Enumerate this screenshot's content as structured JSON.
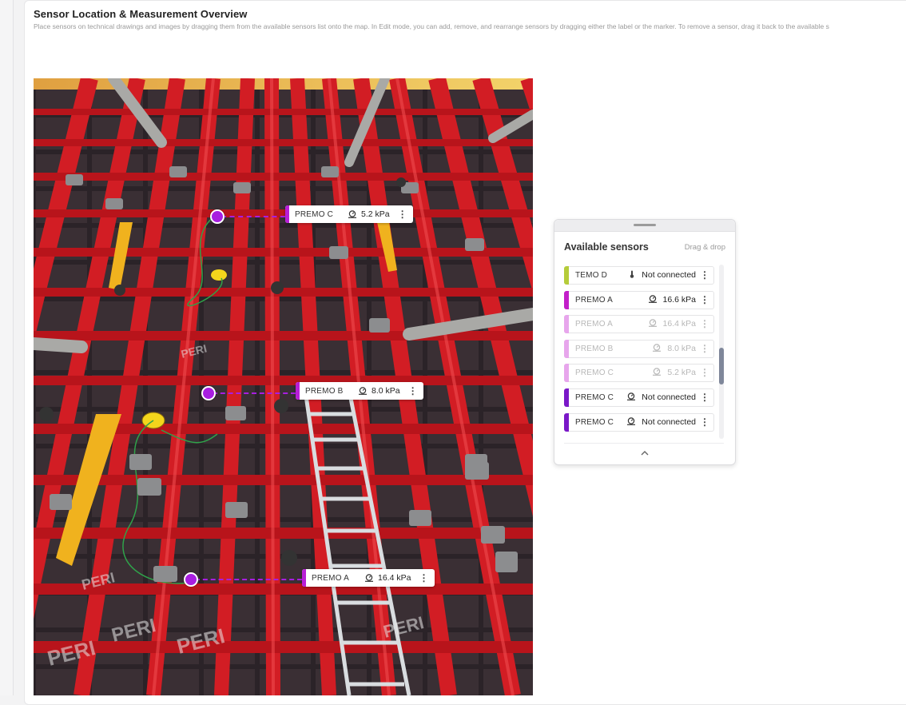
{
  "page": {
    "title": "Sensor Location & Measurement Overview",
    "description": "Place sensors on technical drawings and images by dragging them from the available sensors list onto the map. In Edit mode, you can add, remove, and rearrange sensors by dragging either the label or the marker. To remove a sensor, drag it back to the available s"
  },
  "map": {
    "placed_sensors": [
      {
        "name": "PREMO C",
        "value": "5.2 kPa",
        "icon": "pressure-gauge-icon",
        "color": "#b81ed6"
      },
      {
        "name": "PREMO B",
        "value": "8.0 kPa",
        "icon": "pressure-gauge-icon",
        "color": "#b81ed6"
      },
      {
        "name": "PREMO A",
        "value": "16.4 kPa",
        "icon": "pressure-gauge-icon",
        "color": "#b81ed6"
      }
    ]
  },
  "panel": {
    "title": "Available sensors",
    "hint": "Drag & drop",
    "sensors": [
      {
        "name": "TEMO D",
        "value": "Not connected",
        "icon": "thermometer-icon",
        "color": "#b5cc3a",
        "faded": false
      },
      {
        "name": "PREMO A",
        "value": "16.6 kPa",
        "icon": "pressure-gauge-icon",
        "color": "#c21fc9",
        "faded": false
      },
      {
        "name": "PREMO A",
        "value": "16.4 kPa",
        "icon": "pressure-gauge-icon",
        "color": "#e7a6ec",
        "faded": true
      },
      {
        "name": "PREMO B",
        "value": "8.0 kPa",
        "icon": "pressure-gauge-icon",
        "color": "#e7a6ec",
        "faded": true
      },
      {
        "name": "PREMO C",
        "value": "5.2 kPa",
        "icon": "pressure-gauge-icon",
        "color": "#e7a6ec",
        "faded": true
      },
      {
        "name": "PREMO C",
        "value": "Not connected",
        "icon": "pressure-gauge-icon",
        "color": "#7a18c8",
        "faded": false
      },
      {
        "name": "PREMO C",
        "value": "Not connected",
        "icon": "pressure-gauge-icon",
        "color": "#7a18c8",
        "faded": false
      }
    ]
  },
  "colors": {
    "marker": "#a81ee0",
    "formwork_red": "#c4161c"
  }
}
